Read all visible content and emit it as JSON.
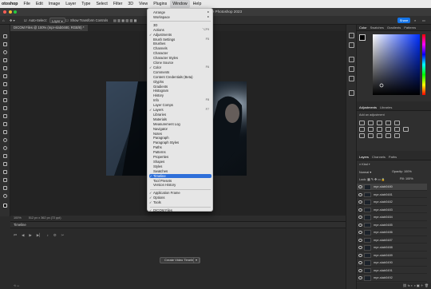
{
  "menubar": {
    "app_name": "otoshop",
    "items": [
      "File",
      "Edit",
      "Image",
      "Layer",
      "Type",
      "Select",
      "Filter",
      "3D",
      "View",
      "Plugins",
      "Window",
      "Help"
    ]
  },
  "titlebar": {
    "title": "Adobe Photoshop 2023"
  },
  "options_bar": {
    "auto_select": "Auto-Select:",
    "layer_select": "Layer",
    "show_transform": "Show Transform Controls",
    "share_label": "Share"
  },
  "document": {
    "tab_label": "DICOM Files @ 100% (mpr-slab0480, RGB/8) *",
    "zoom": "100%",
    "doc_size": "512 px x 362 px (72 ppi)"
  },
  "window_menu": {
    "rows": [
      {
        "label": "Arrange",
        "arrow": "▸"
      },
      {
        "label": "Workspace",
        "arrow": "▸"
      },
      {
        "sep": true
      },
      {
        "label": "3D"
      },
      {
        "label": "Actions",
        "shortcut": "⌥F9"
      },
      {
        "label": "Adjustments",
        "check": true
      },
      {
        "label": "Brush Settings",
        "shortcut": "F5"
      },
      {
        "label": "Brushes"
      },
      {
        "label": "Channels"
      },
      {
        "label": "Character"
      },
      {
        "label": "Character Styles"
      },
      {
        "label": "Clone Source"
      },
      {
        "label": "Color",
        "check": true,
        "shortcut": "F6"
      },
      {
        "label": "Comments"
      },
      {
        "label": "Content Credentials (Beta)"
      },
      {
        "label": "Glyphs"
      },
      {
        "label": "Gradients"
      },
      {
        "label": "Histogram"
      },
      {
        "label": "History"
      },
      {
        "label": "Info",
        "shortcut": "F8"
      },
      {
        "label": "Layer Comps"
      },
      {
        "label": "Layers",
        "check": true,
        "shortcut": "F7"
      },
      {
        "label": "Libraries"
      },
      {
        "label": "Materials"
      },
      {
        "label": "Measurement Log"
      },
      {
        "label": "Navigator"
      },
      {
        "label": "Notes"
      },
      {
        "label": "Paragraph"
      },
      {
        "label": "Paragraph Styles"
      },
      {
        "label": "Paths"
      },
      {
        "label": "Patterns"
      },
      {
        "label": "Properties"
      },
      {
        "label": "Shapes"
      },
      {
        "label": "Styles"
      },
      {
        "label": "Swatches"
      },
      {
        "label": "Timeline",
        "check": true,
        "highlighted": true
      },
      {
        "label": "Tool Presets"
      },
      {
        "label": "Version History"
      },
      {
        "sep": true
      },
      {
        "label": "Application Frame",
        "check": true
      },
      {
        "label": "Options",
        "check": true
      },
      {
        "label": "Tools",
        "check": true
      },
      {
        "sep": true
      },
      {
        "label": "DICOM Files",
        "check": true
      }
    ]
  },
  "color_panel": {
    "tabs": [
      "Color",
      "Swatches",
      "Gradients",
      "Patterns"
    ]
  },
  "adjustments_panel": {
    "tabs": [
      "Adjustments",
      "Libraries"
    ],
    "hint": "Add an adjustment"
  },
  "layers_panel": {
    "tabs": [
      "Layers",
      "Channels",
      "Paths"
    ],
    "kind": "Kind",
    "blend": "Normal",
    "opacity": "Opacity: 100%",
    "lock": "Lock:",
    "fill": "Fill: 100%",
    "layers": [
      "mpr-slab0480",
      "mpr-slab0481",
      "mpr-slab0482",
      "mpr-slab0483",
      "mpr-slab0484",
      "mpr-slab0485",
      "mpr-slab0486",
      "mpr-slab0487",
      "mpr-slab0488",
      "mpr-slab0489",
      "mpr-slab0490",
      "mpr-slab0491",
      "mpr-slab0492"
    ],
    "selected_index": 0
  },
  "timeline": {
    "title": "Timeline",
    "create_button": "Create Video Timeline"
  },
  "colors": {
    "accent": "#2e6fd9",
    "share": "#1473e6"
  }
}
